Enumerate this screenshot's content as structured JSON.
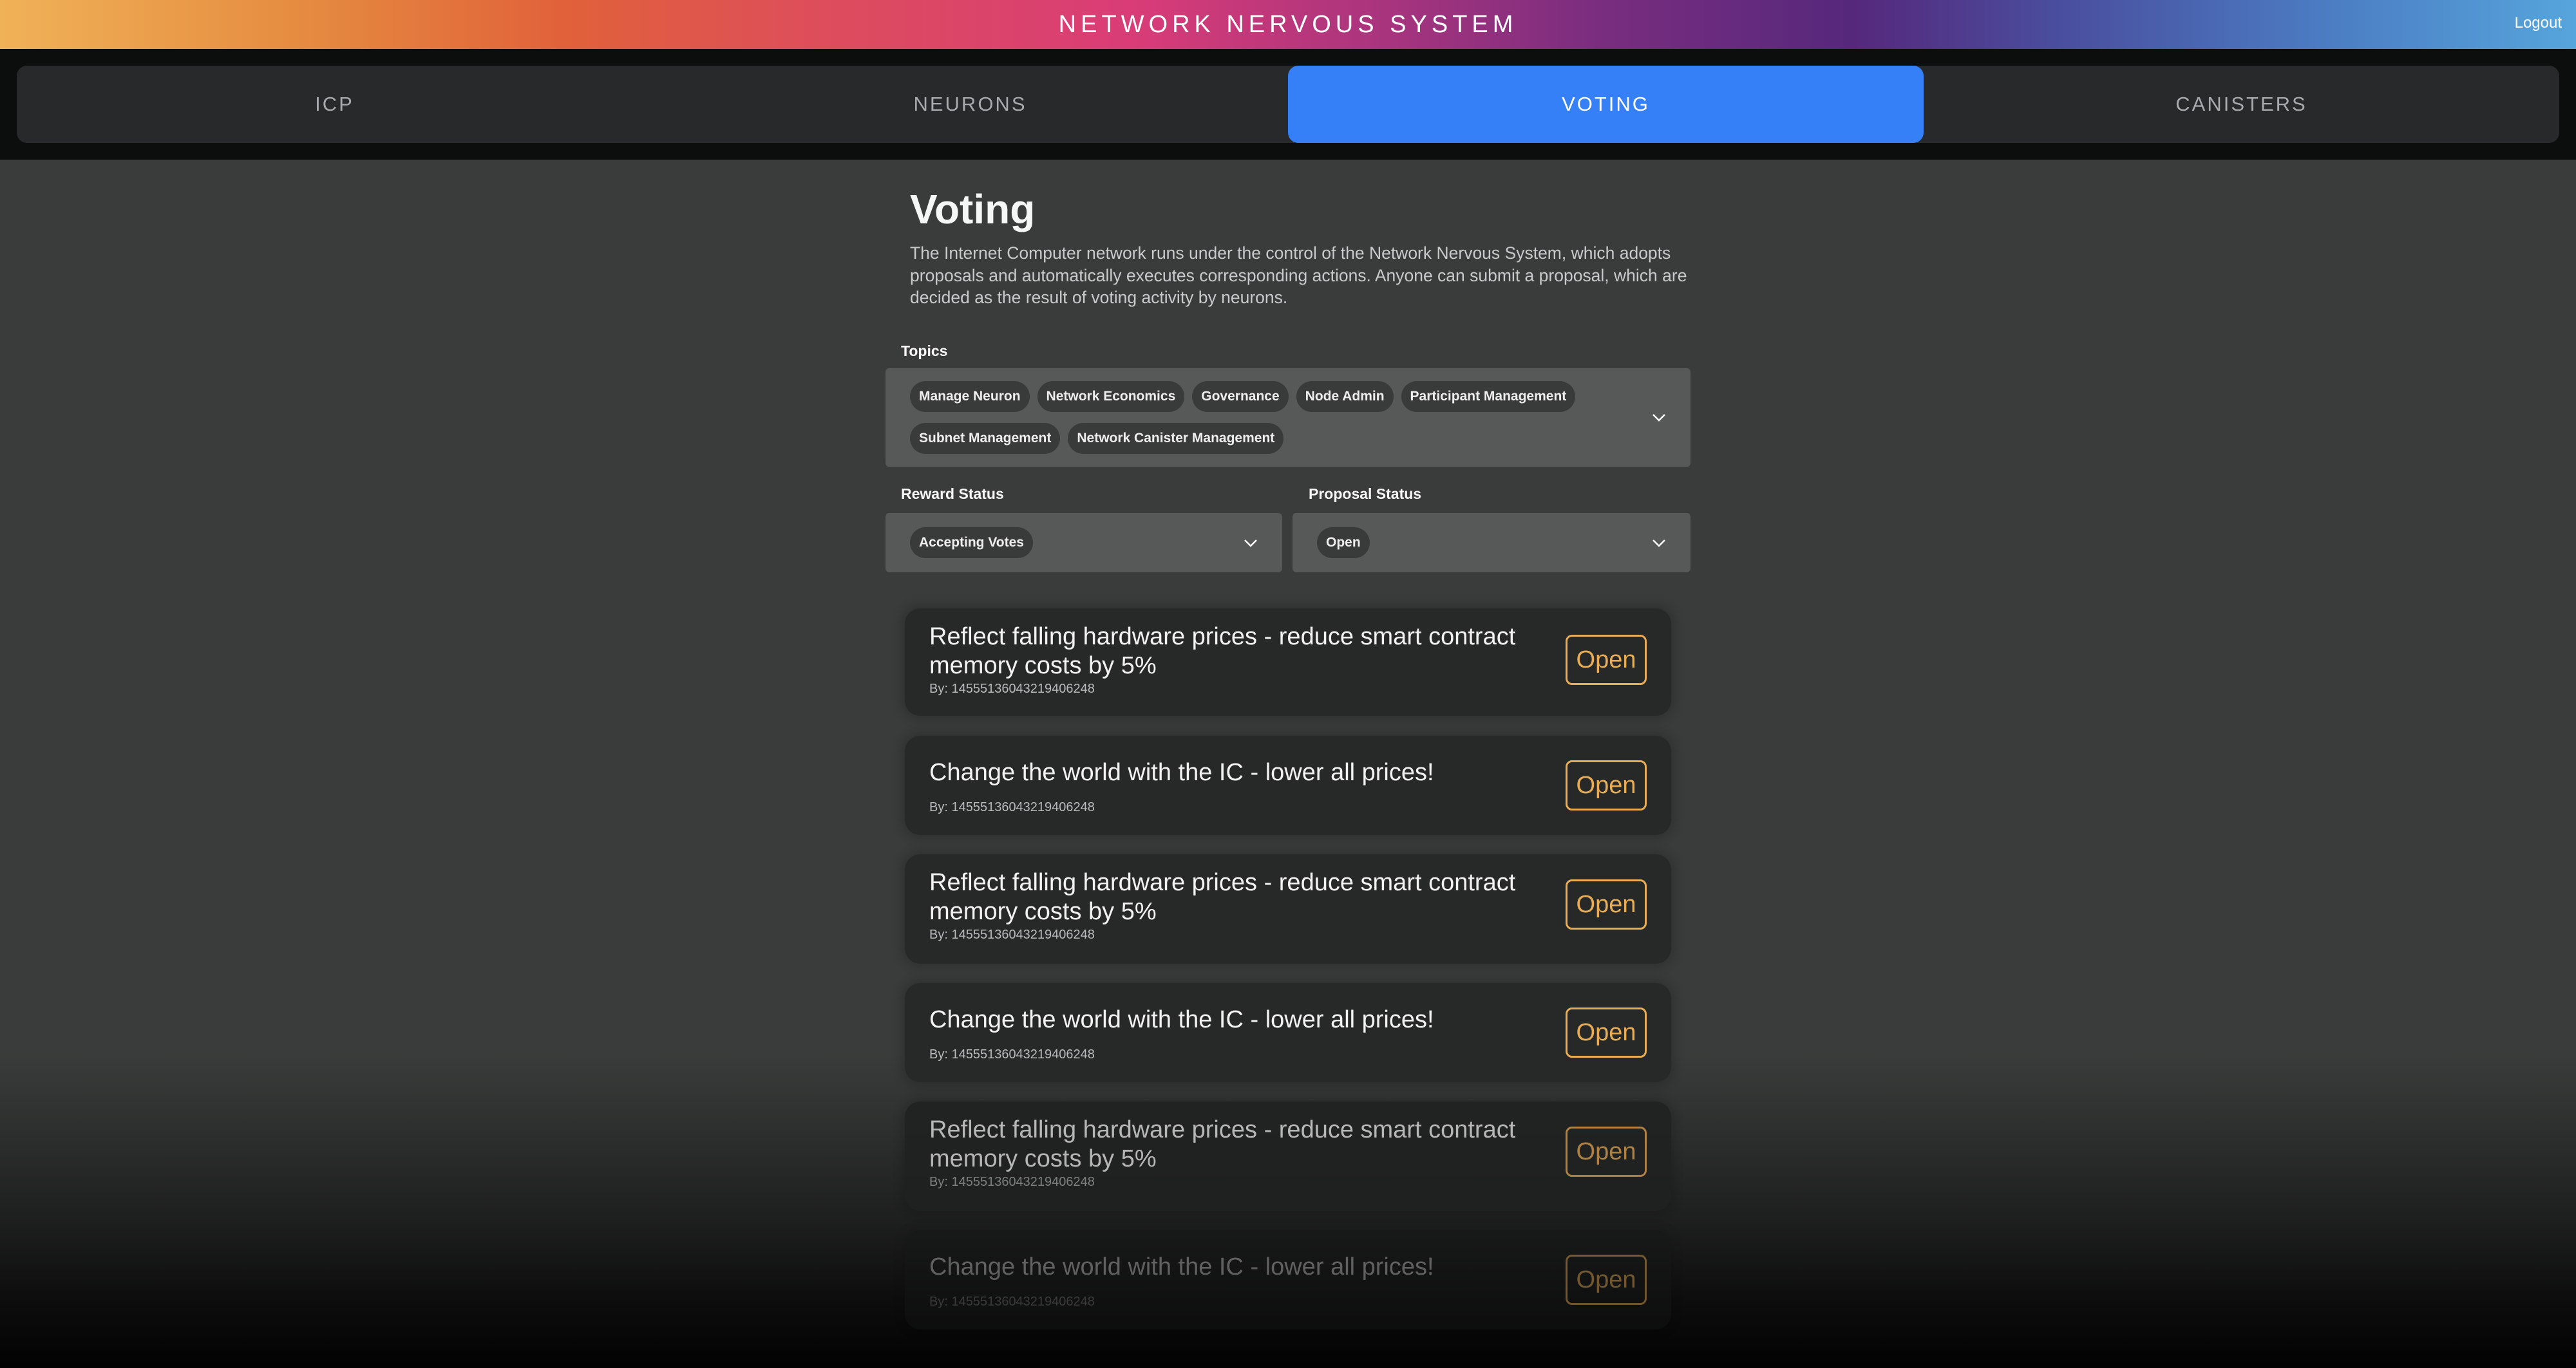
{
  "header": {
    "title": "NETWORK NERVOUS SYSTEM",
    "logout_label": "Logout",
    "gradient_colors": [
      "#f0b257",
      "#e1613a",
      "#d93c77",
      "#55287c",
      "#56a5dc"
    ]
  },
  "nav": {
    "tabs": [
      {
        "label": "ICP",
        "active": false
      },
      {
        "label": "NEURONS",
        "active": false
      },
      {
        "label": "VOTING",
        "active": true
      },
      {
        "label": "CANISTERS",
        "active": false
      }
    ],
    "active_color": "#3580f6"
  },
  "page": {
    "title": "Voting",
    "description": "The Internet Computer network runs under the control of the Network Nervous System, which adopts proposals and automatically executes corresponding actions. Anyone can submit a proposal, which are decided as the result of voting activity by neurons."
  },
  "filters": {
    "topics": {
      "label": "Topics",
      "selected": [
        "Manage Neuron",
        "Network Economics",
        "Governance",
        "Node Admin",
        "Participant Management",
        "Subnet Management",
        "Network Canister Management"
      ]
    },
    "reward_status": {
      "label": "Reward Status",
      "selected": [
        "Accepting Votes"
      ]
    },
    "proposal_status": {
      "label": "Proposal Status",
      "selected": [
        "Open"
      ]
    }
  },
  "proposals": [
    {
      "title": "Reflect falling hardware prices - reduce smart contract memory costs by 5%",
      "by": "By: 14555136043219406248",
      "status": "Open"
    },
    {
      "title": "Change the world with the IC - lower all prices!",
      "by": "By: 14555136043219406248",
      "status": "Open"
    },
    {
      "title": "Reflect falling hardware prices - reduce smart contract memory costs by 5%",
      "by": "By: 14555136043219406248",
      "status": "Open"
    },
    {
      "title": "Change the world with the IC - lower all prices!",
      "by": "By: 14555136043219406248",
      "status": "Open"
    },
    {
      "title": "Reflect falling hardware prices - reduce smart contract memory costs by 5%",
      "by": "By: 14555136043219406248",
      "status": "Open"
    },
    {
      "title": "Change the world with the IC - lower all prices!",
      "by": "By: 14555136043219406248",
      "status": "Open"
    }
  ],
  "colors": {
    "status_open": "#e8ad55",
    "card_bg": "#272828",
    "page_bg": "#3a3c3b"
  }
}
